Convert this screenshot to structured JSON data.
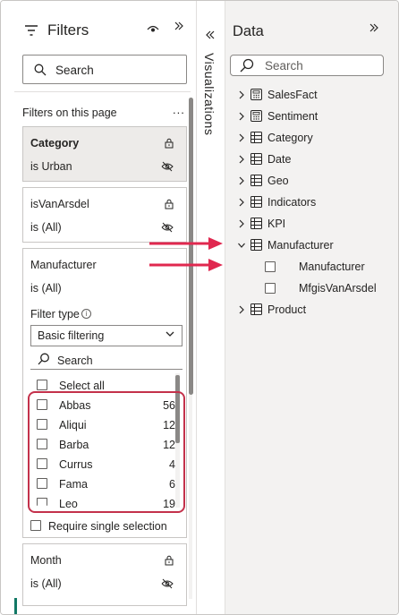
{
  "filters": {
    "title": "Filters",
    "search_placeholder": "Search",
    "section_label": "Filters on this page",
    "more": "...",
    "cards": [
      {
        "title": "Category",
        "sub": "is Urban"
      },
      {
        "title": "isVanArsdel",
        "sub": "is (All)"
      },
      {
        "title": "Manufacturer",
        "sub": "is (All)"
      },
      {
        "title": "Month",
        "sub": "is (All)"
      }
    ],
    "filter_type_label": "Filter type",
    "filter_type_value": "Basic filtering",
    "inner_search_placeholder": "Search",
    "select_all": "Select all",
    "options": [
      {
        "label": "Abbas",
        "count": "56"
      },
      {
        "label": "Aliqui",
        "count": "12"
      },
      {
        "label": "Barba",
        "count": "12"
      },
      {
        "label": "Currus",
        "count": "4"
      },
      {
        "label": "Fama",
        "count": "6"
      },
      {
        "label": "Leo",
        "count": "19"
      }
    ],
    "require_single": "Require single selection"
  },
  "visualizations": {
    "label": "Visualizations"
  },
  "data_pane": {
    "title": "Data",
    "search_placeholder": "Search",
    "tables": [
      {
        "label": "SalesFact",
        "icon": "calculator-table-icon",
        "expanded": false
      },
      {
        "label": "Sentiment",
        "icon": "calculator-table-icon",
        "expanded": false
      },
      {
        "label": "Category",
        "icon": "table-icon",
        "expanded": false
      },
      {
        "label": "Date",
        "icon": "table-icon",
        "expanded": false
      },
      {
        "label": "Geo",
        "icon": "table-icon",
        "expanded": false
      },
      {
        "label": "Indicators",
        "icon": "table-icon",
        "expanded": false
      },
      {
        "label": "KPI",
        "icon": "table-icon",
        "expanded": false
      },
      {
        "label": "Manufacturer",
        "icon": "table-icon",
        "expanded": true
      },
      {
        "label": "Product",
        "icon": "table-icon",
        "expanded": false
      }
    ],
    "manufacturer_fields": [
      "Manufacturer",
      "MfgisVanArsdel"
    ]
  },
  "colors": {
    "highlight": "#c4314b",
    "arrow": "#e0284f",
    "accent": "#117865"
  }
}
